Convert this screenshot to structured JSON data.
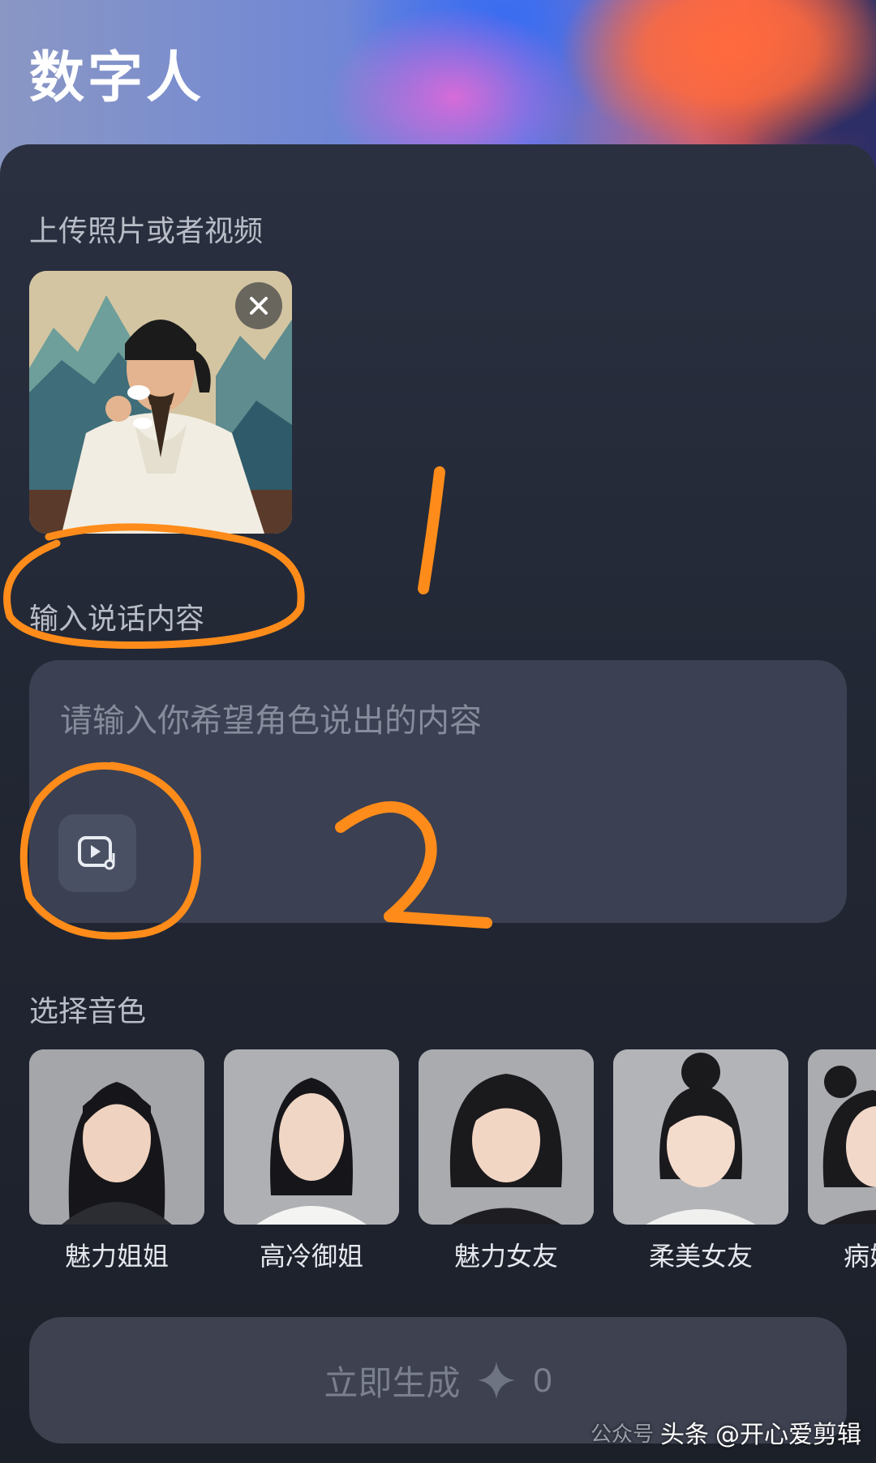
{
  "header": {
    "title": "数字人"
  },
  "upload": {
    "label": "上传照片或者视频"
  },
  "speech": {
    "label": "输入说话内容",
    "placeholder": "请输入你希望角色说出的内容"
  },
  "voices": {
    "label": "选择音色",
    "items": [
      {
        "name": "魅力姐姐"
      },
      {
        "name": "高冷御姐"
      },
      {
        "name": "魅力女友"
      },
      {
        "name": "柔美女友"
      },
      {
        "name": "病娇"
      }
    ]
  },
  "generate": {
    "label": "立即生成",
    "credits": "0"
  },
  "annotations": {
    "mark1": "1",
    "mark2": "2",
    "color": "#ff8c1a"
  },
  "watermark": {
    "source": "公众号",
    "brand": "头条",
    "account": "@开心爱剪辑"
  },
  "colors": {
    "background": "#1d212b",
    "input_bg": "#3b4052",
    "accent": "#ff8c1a"
  }
}
